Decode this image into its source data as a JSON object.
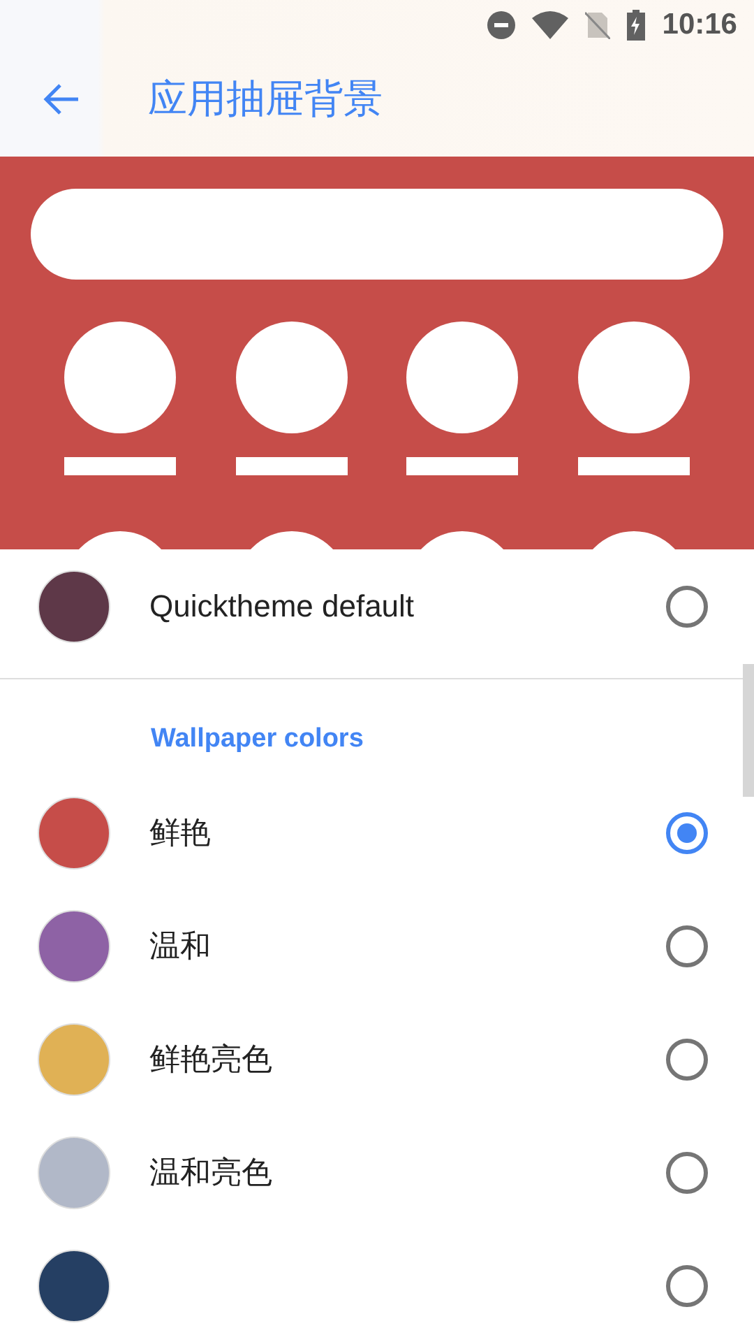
{
  "status_bar": {
    "time": "10:16"
  },
  "toolbar": {
    "title": "应用抽屉背景"
  },
  "default_option": {
    "label": "Quicktheme default",
    "color": "#5e3848",
    "selected": false
  },
  "section": {
    "title": "Wallpaper colors"
  },
  "options": [
    {
      "label": "鲜艳",
      "color": "#c64d49",
      "selected": true
    },
    {
      "label": "温和",
      "color": "#8e62a5",
      "selected": false
    },
    {
      "label": "鲜艳亮色",
      "color": "#e0b155",
      "selected": false
    },
    {
      "label": "温和亮色",
      "color": "#b1b8c8",
      "selected": false
    },
    {
      "color": "#253f63",
      "selected": false
    }
  ]
}
